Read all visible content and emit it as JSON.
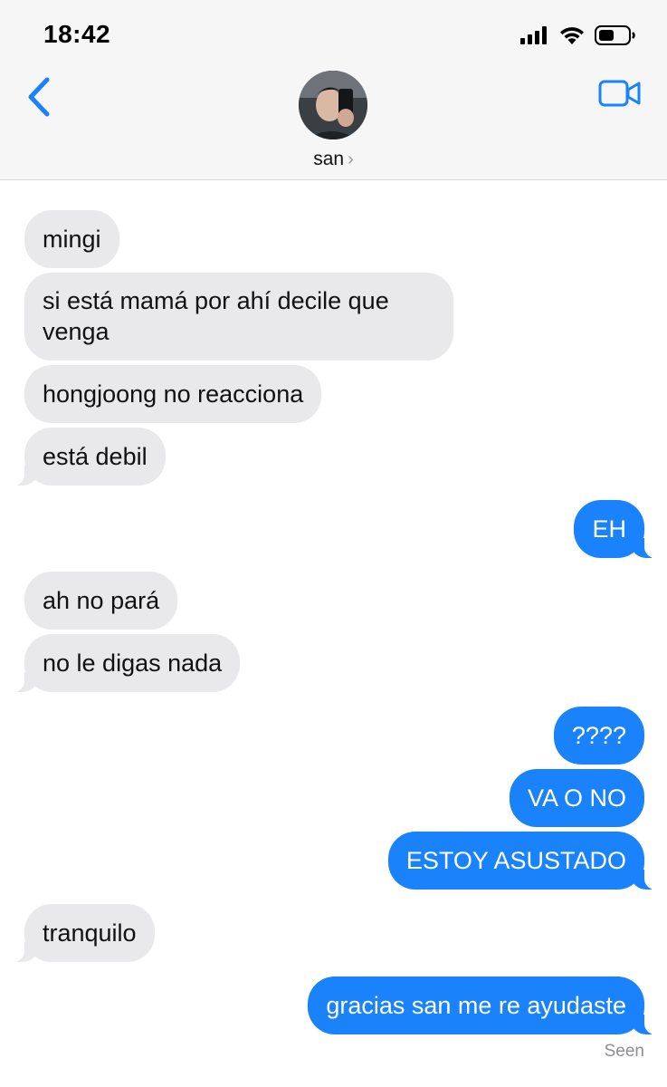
{
  "status_bar": {
    "time": "18:42",
    "battery_icon": "battery-icon",
    "wifi_icon": "wifi-icon",
    "signal_icon": "signal-icon"
  },
  "header": {
    "contact_name": "san",
    "chevron": "›",
    "back_icon": "chevron-left-icon",
    "video_icon": "video-camera-icon"
  },
  "colors": {
    "accent": "#1a82fb",
    "incoming_bubble": "#e9e9eb",
    "header_bg": "#f6f6f7"
  },
  "messages": [
    {
      "direction": "incoming",
      "text": "mingi"
    },
    {
      "direction": "incoming",
      "text": "si está mamá por ahí decile que venga"
    },
    {
      "direction": "incoming",
      "text": "hongjoong no reacciona"
    },
    {
      "direction": "incoming",
      "text": "está debil"
    },
    {
      "direction": "outgoing",
      "text": "EH"
    },
    {
      "direction": "incoming",
      "text": "ah no pará"
    },
    {
      "direction": "incoming",
      "text": "no le digas nada"
    },
    {
      "direction": "outgoing",
      "text": "????"
    },
    {
      "direction": "outgoing",
      "text": "VA O NO"
    },
    {
      "direction": "outgoing",
      "text": "ESTOY ASUSTADO"
    },
    {
      "direction": "incoming",
      "text": "tranquilo"
    },
    {
      "direction": "outgoing",
      "text": "gracias san me re ayudaste"
    }
  ],
  "read_receipt": "Seen"
}
